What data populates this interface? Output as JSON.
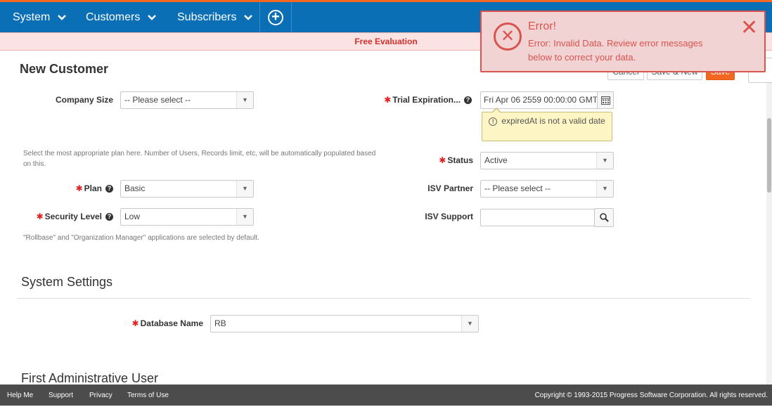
{
  "nav": {
    "items": [
      {
        "label": "System"
      },
      {
        "label": "Customers"
      },
      {
        "label": "Subscribers"
      }
    ],
    "add_icon": "plus-circle-icon"
  },
  "banner": {
    "text": "Free Evaluation"
  },
  "page": {
    "title": "New Customer"
  },
  "actions": {
    "cancel": "Cancel",
    "save_new": "Save & New",
    "save": "Save"
  },
  "form": {
    "company_size": {
      "label": "Company Size",
      "value": "-- Please select --"
    },
    "plan_hint": "Select the most appropriate plan here. Number of Users, Records limit, etc, will be automatically populated based on this.",
    "plan": {
      "label": "Plan",
      "value": "Basic"
    },
    "security_level": {
      "label": "Security Level",
      "value": "Low"
    },
    "security_hint": "\"Rollbase\" and \"Organization Manager\" applications are selected by default.",
    "trial_expiration": {
      "label": "Trial Expiration...",
      "value": "Fri Apr 06 2559 00:00:00 GMT"
    },
    "trial_error": "expiredAt is not a valid date",
    "status": {
      "label": "Status",
      "value": "Active"
    },
    "isv_partner": {
      "label": "ISV Partner",
      "value": "-- Please select --"
    },
    "isv_support": {
      "label": "ISV Support",
      "value": ""
    }
  },
  "system_settings": {
    "title": "System Settings",
    "database_name": {
      "label": "Database Name",
      "value": "RB"
    }
  },
  "admin_user": {
    "title": "First Administrative User"
  },
  "error": {
    "title": "Error!",
    "message": "Error: Invalid Data. Review error messages below to correct your data.",
    "color": "#d9534f"
  },
  "footer": {
    "links": [
      "Help Me",
      "Support",
      "Privacy",
      "Terms of Use"
    ],
    "copyright": "Copyright © 1993-2015 Progress Software Corporation. All rights reserved."
  },
  "colors": {
    "nav": "#0b6fb5",
    "accent": "#f26722",
    "required": "#e02020"
  }
}
